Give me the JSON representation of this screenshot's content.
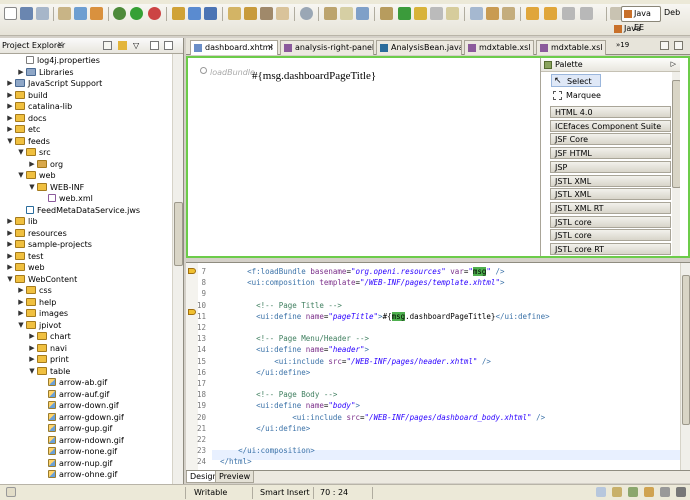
{
  "explorer": {
    "title": "Project Explorer",
    "close": "✕",
    "tree": [
      {
        "label": "log4j.properties",
        "depth": 2,
        "icon": "file",
        "twisty": ""
      },
      {
        "label": "Libraries",
        "depth": 2,
        "icon": "lib",
        "twisty": "+"
      },
      {
        "label": "JavaScript Support",
        "depth": 1,
        "icon": "lib",
        "twisty": "+"
      },
      {
        "label": "build",
        "depth": 1,
        "icon": "folder",
        "twisty": "+"
      },
      {
        "label": "catalina-lib",
        "depth": 1,
        "icon": "folder",
        "twisty": "+"
      },
      {
        "label": "docs",
        "depth": 1,
        "icon": "folder",
        "twisty": "+"
      },
      {
        "label": "etc",
        "depth": 1,
        "icon": "folder",
        "twisty": "+"
      },
      {
        "label": "feeds",
        "depth": 1,
        "icon": "folder",
        "twisty": "-"
      },
      {
        "label": "src",
        "depth": 2,
        "icon": "folder",
        "twisty": "-"
      },
      {
        "label": "org",
        "depth": 3,
        "icon": "pkg",
        "twisty": "+"
      },
      {
        "label": "web",
        "depth": 2,
        "icon": "folder",
        "twisty": "-"
      },
      {
        "label": "WEB-INF",
        "depth": 3,
        "icon": "folder",
        "twisty": "-"
      },
      {
        "label": "web.xml",
        "depth": 4,
        "icon": "xml",
        "twisty": ""
      },
      {
        "label": "FeedMetaDataService.jws",
        "depth": 2,
        "icon": "java",
        "twisty": ""
      },
      {
        "label": "lib",
        "depth": 1,
        "icon": "folder",
        "twisty": "+"
      },
      {
        "label": "resources",
        "depth": 1,
        "icon": "folder",
        "twisty": "+"
      },
      {
        "label": "sample-projects",
        "depth": 1,
        "icon": "folder",
        "twisty": "+"
      },
      {
        "label": "test",
        "depth": 1,
        "icon": "folder",
        "twisty": "+"
      },
      {
        "label": "web",
        "depth": 1,
        "icon": "folder",
        "twisty": "+"
      },
      {
        "label": "WebContent",
        "depth": 1,
        "icon": "folder",
        "twisty": "-"
      },
      {
        "label": "css",
        "depth": 2,
        "icon": "folder",
        "twisty": "+"
      },
      {
        "label": "help",
        "depth": 2,
        "icon": "folder",
        "twisty": "+"
      },
      {
        "label": "images",
        "depth": 2,
        "icon": "folder",
        "twisty": "+"
      },
      {
        "label": "jpivot",
        "depth": 2,
        "icon": "folder",
        "twisty": "-"
      },
      {
        "label": "chart",
        "depth": 3,
        "icon": "folder",
        "twisty": "+"
      },
      {
        "label": "navi",
        "depth": 3,
        "icon": "folder",
        "twisty": "+"
      },
      {
        "label": "print",
        "depth": 3,
        "icon": "folder",
        "twisty": "+"
      },
      {
        "label": "table",
        "depth": 3,
        "icon": "folder",
        "twisty": "-"
      },
      {
        "label": "arrow-ab.gif",
        "depth": 4,
        "icon": "gif",
        "twisty": ""
      },
      {
        "label": "arrow-auf.gif",
        "depth": 4,
        "icon": "gif",
        "twisty": ""
      },
      {
        "label": "arrow-down.gif",
        "depth": 4,
        "icon": "gif",
        "twisty": ""
      },
      {
        "label": "arrow-gdown.gif",
        "depth": 4,
        "icon": "gif",
        "twisty": ""
      },
      {
        "label": "arrow-gup.gif",
        "depth": 4,
        "icon": "gif",
        "twisty": ""
      },
      {
        "label": "arrow-ndown.gif",
        "depth": 4,
        "icon": "gif",
        "twisty": ""
      },
      {
        "label": "arrow-none.gif",
        "depth": 4,
        "icon": "gif",
        "twisty": ""
      },
      {
        "label": "arrow-nup.gif",
        "depth": 4,
        "icon": "gif",
        "twisty": ""
      },
      {
        "label": "arrow-ohne.gif",
        "depth": 4,
        "icon": "gif",
        "twisty": ""
      }
    ]
  },
  "perspectives": {
    "javaee": "Java EE",
    "debug": "Deb",
    "java": "Java"
  },
  "editor": {
    "tabs": [
      {
        "label": "dashboard.xhtml",
        "active": true,
        "icon_color": "#6a8ec8"
      },
      {
        "label": "analysis-right-panel",
        "active": false,
        "icon_color": "#8b5a9c"
      },
      {
        "label": "AnalysisBean.java",
        "active": false,
        "icon_color": "#2a6c9c"
      },
      {
        "label": "mdxtable.xsl",
        "active": false,
        "icon_color": "#8b5a9c"
      },
      {
        "label": "mdxtable.xsl",
        "active": false,
        "icon_color": "#8b5a9c"
      }
    ],
    "overflow": "»19",
    "design": {
      "loadbundle_label": "loadBundle",
      "text": "#{msg.dashboardPageTitle}"
    },
    "palette": {
      "title": "Palette",
      "tools": [
        "Select",
        "Marquee"
      ],
      "drawers": [
        "HTML 4.0",
        "ICEfaces Component Suite",
        "JSF Core",
        "JSF HTML",
        "JSP",
        "JSTL XML",
        "JSTL XML",
        "JSTL XML RT",
        "JSTL core",
        "JSTL core",
        "JSTL core RT"
      ]
    },
    "source": {
      "line_numbers": [
        "7",
        "8",
        "9",
        "10",
        "11",
        "12",
        "13",
        "14",
        "15",
        "16",
        "17",
        "18",
        "19",
        "20",
        "21",
        "22",
        "23",
        "24"
      ],
      "lines": [
        {
          "indent": "      ",
          "parts": [
            [
              "tag",
              "<f:loadBundle "
            ],
            [
              "attr",
              "basename"
            ],
            [
              "",
              "="
            ],
            [
              "val",
              "\"org.openi.resources\""
            ],
            [
              "",
              " "
            ],
            [
              "attr",
              "var"
            ],
            [
              "",
              "="
            ],
            [
              "val",
              "\""
            ],
            [
              "hl",
              "msg"
            ],
            [
              "val",
              "\""
            ],
            [
              "tag",
              " />"
            ]
          ]
        },
        {
          "indent": "      ",
          "parts": [
            [
              "tag",
              "<ui:composition "
            ],
            [
              "attr",
              "template"
            ],
            [
              "",
              "="
            ],
            [
              "val",
              "\"/WEB-INF/pages/template.xhtml\""
            ],
            [
              "tag",
              ">"
            ]
          ]
        },
        {
          "indent": "",
          "parts": []
        },
        {
          "indent": "        ",
          "parts": [
            [
              "comment",
              "<!-- Page Title -->"
            ]
          ]
        },
        {
          "indent": "        ",
          "parts": [
            [
              "tag",
              "<ui:define "
            ],
            [
              "attr",
              "name"
            ],
            [
              "",
              "="
            ],
            [
              "val",
              "\"pageTitle\""
            ],
            [
              "tag",
              ">"
            ],
            [
              "",
              "#{"
            ],
            [
              "hl",
              "msg"
            ],
            [
              "",
              ".dashboardPageTitle}"
            ],
            [
              "tag",
              "</ui:define>"
            ]
          ]
        },
        {
          "indent": "",
          "parts": []
        },
        {
          "indent": "        ",
          "parts": [
            [
              "comment",
              "<!-- Page Menu/Header -->"
            ]
          ]
        },
        {
          "indent": "        ",
          "parts": [
            [
              "tag",
              "<ui:define "
            ],
            [
              "attr",
              "name"
            ],
            [
              "",
              "="
            ],
            [
              "val",
              "\"header\""
            ],
            [
              "tag",
              ">"
            ]
          ]
        },
        {
          "indent": "            ",
          "parts": [
            [
              "tag",
              "<ui:include "
            ],
            [
              "attr",
              "src"
            ],
            [
              "",
              "="
            ],
            [
              "val",
              "\"/WEB-INF/pages/header.xhtml\""
            ],
            [
              "tag",
              " />"
            ]
          ]
        },
        {
          "indent": "        ",
          "parts": [
            [
              "tag",
              "</ui:define>"
            ]
          ]
        },
        {
          "indent": "",
          "parts": []
        },
        {
          "indent": "        ",
          "parts": [
            [
              "comment",
              "<!-- Page Body -->"
            ]
          ]
        },
        {
          "indent": "        ",
          "parts": [
            [
              "tag",
              "<ui:define "
            ],
            [
              "attr",
              "name"
            ],
            [
              "",
              "="
            ],
            [
              "val",
              "\"body\""
            ],
            [
              "tag",
              ">"
            ]
          ]
        },
        {
          "indent": "                ",
          "parts": [
            [
              "tag",
              "<ui:include "
            ],
            [
              "attr",
              "src"
            ],
            [
              "",
              "="
            ],
            [
              "val",
              "\"/WEB-INF/pages/dashboard_body.xhtml\""
            ],
            [
              "tag",
              " />"
            ]
          ]
        },
        {
          "indent": "        ",
          "parts": [
            [
              "tag",
              "</ui:define>"
            ]
          ]
        },
        {
          "indent": "",
          "parts": []
        },
        {
          "indent": "    ",
          "parts": [
            [
              "tag",
              "</ui:composition>"
            ]
          ]
        },
        {
          "indent": "",
          "parts": [
            [
              "tag",
              "</html>"
            ]
          ]
        }
      ]
    },
    "bottom_tabs": [
      "Design",
      "Preview"
    ]
  },
  "status": {
    "mode": "Writable",
    "insert": "Smart Insert",
    "position": "70 : 24"
  },
  "colors": {
    "design_border": "#6ccc4a",
    "highlight": "#4eb04e"
  }
}
